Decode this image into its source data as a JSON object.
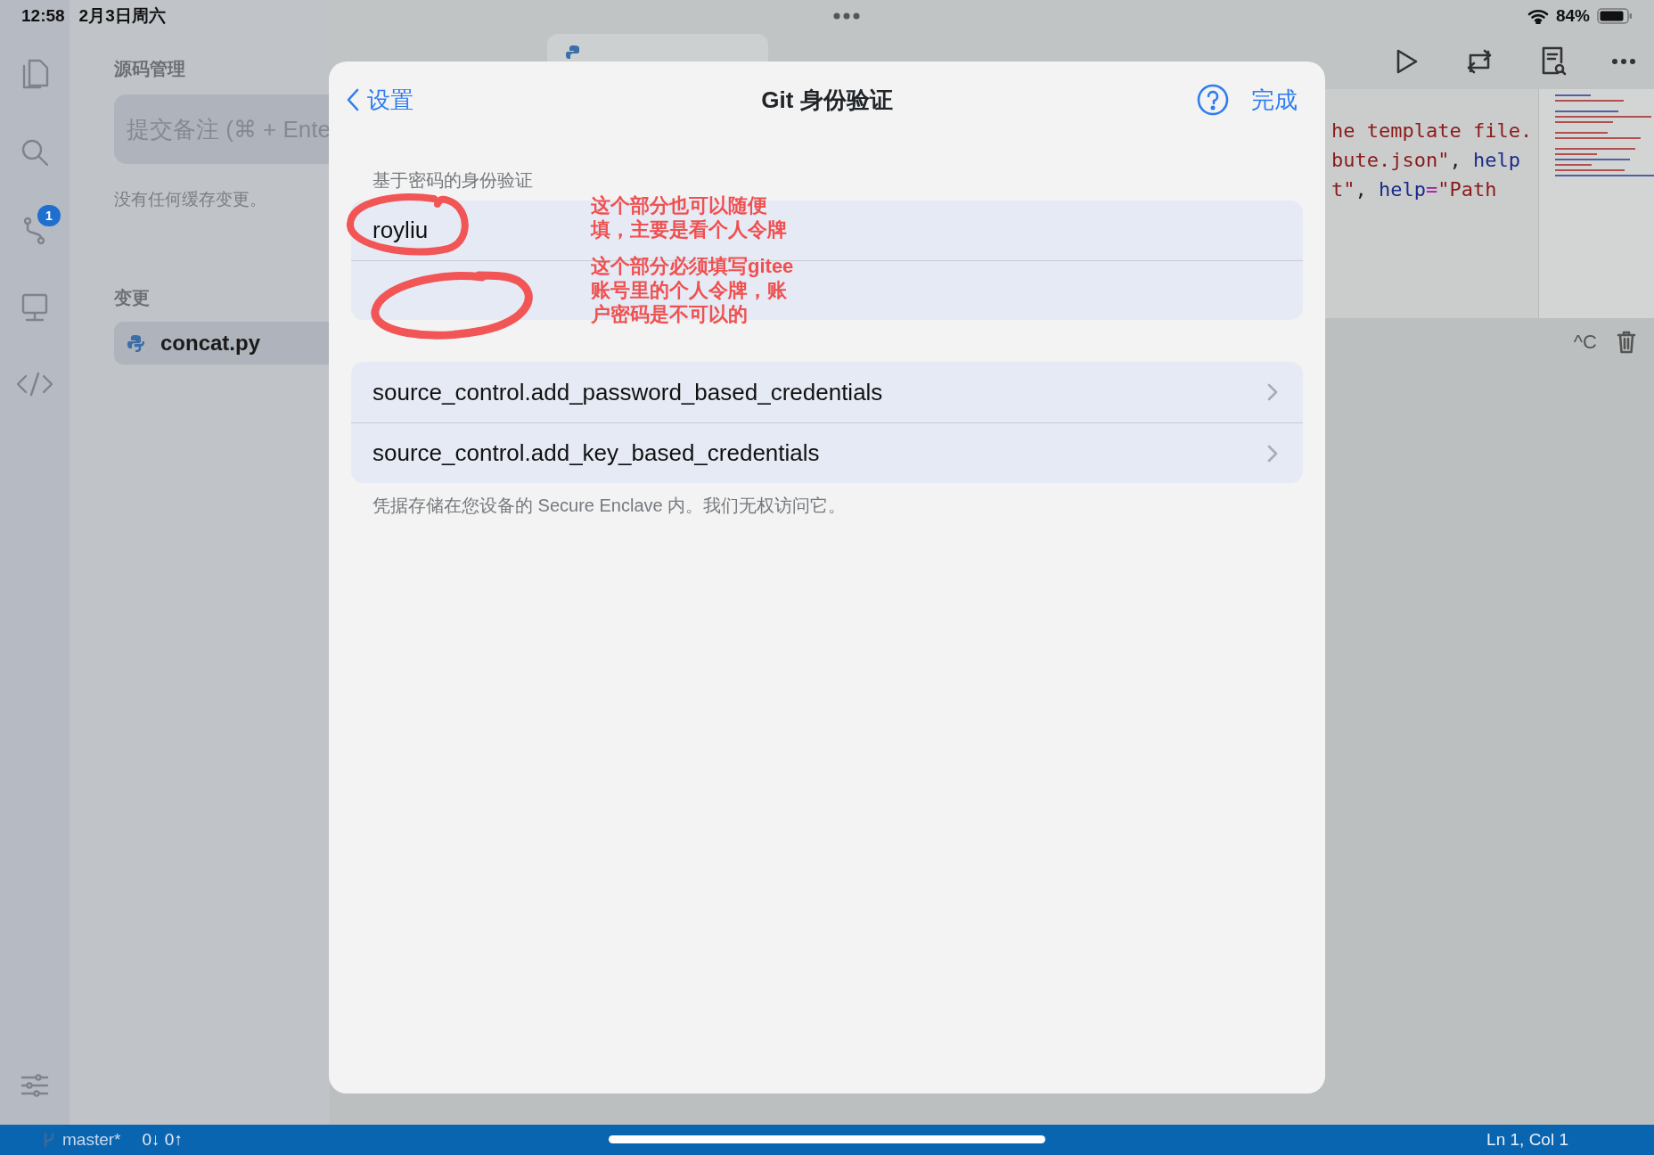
{
  "status_bar": {
    "time": "12:58",
    "date": "2月3日周六",
    "battery": "84%"
  },
  "activity_bar": {
    "source_control_badge": "1"
  },
  "sidebar": {
    "title": "源码管理",
    "commit_field": {
      "placeholder": "提交备注 (⌘ + Ente"
    },
    "empty_note": "没有任何缓存变更。",
    "changes_header": "变更",
    "files": [
      {
        "name": "concat.py"
      }
    ]
  },
  "editor": {
    "code_lines": [
      [
        {
          "text": "he template file.",
          "kind": "string"
        }
      ],
      [
        {
          "text": "bute.json\"",
          "kind": "string"
        },
        {
          "text": ", ",
          "kind": "plain"
        },
        {
          "text": "help",
          "kind": "keyword"
        }
      ],
      [
        {
          "text": "t\"",
          "kind": "string"
        },
        {
          "text": ", ",
          "kind": "plain"
        },
        {
          "text": "help",
          "kind": "keyword"
        },
        {
          "text": "=",
          "kind": "operator"
        },
        {
          "text": "\"Path",
          "kind": "string"
        }
      ]
    ],
    "terminal": {
      "interrupt": "^C"
    }
  },
  "dialog": {
    "back": "设置",
    "title": "Git 身份验证",
    "done": "完成",
    "section_header": "基于密码的身份验证",
    "fields": [
      {
        "kind": "username",
        "value": "royliu"
      },
      {
        "kind": "password"
      }
    ],
    "rows": [
      {
        "label": "source_control.add_password_based_credentials"
      },
      {
        "label": "source_control.add_key_based_credentials"
      }
    ],
    "footer": "凭据存储在您设备的 Secure Enclave 内。我们无权访问它。"
  },
  "annotations": [
    {
      "lines": [
        "这个部分也可以随便",
        "填，主要是看个人令牌"
      ]
    },
    {
      "lines": [
        "这个部分必须填写gitee",
        "账号里的个人令牌，账",
        "户密码是不可以的"
      ]
    }
  ],
  "footer": {
    "branch": "master*",
    "sync": "0↓ 0↑",
    "cursor": "Ln 1, Col 1"
  }
}
